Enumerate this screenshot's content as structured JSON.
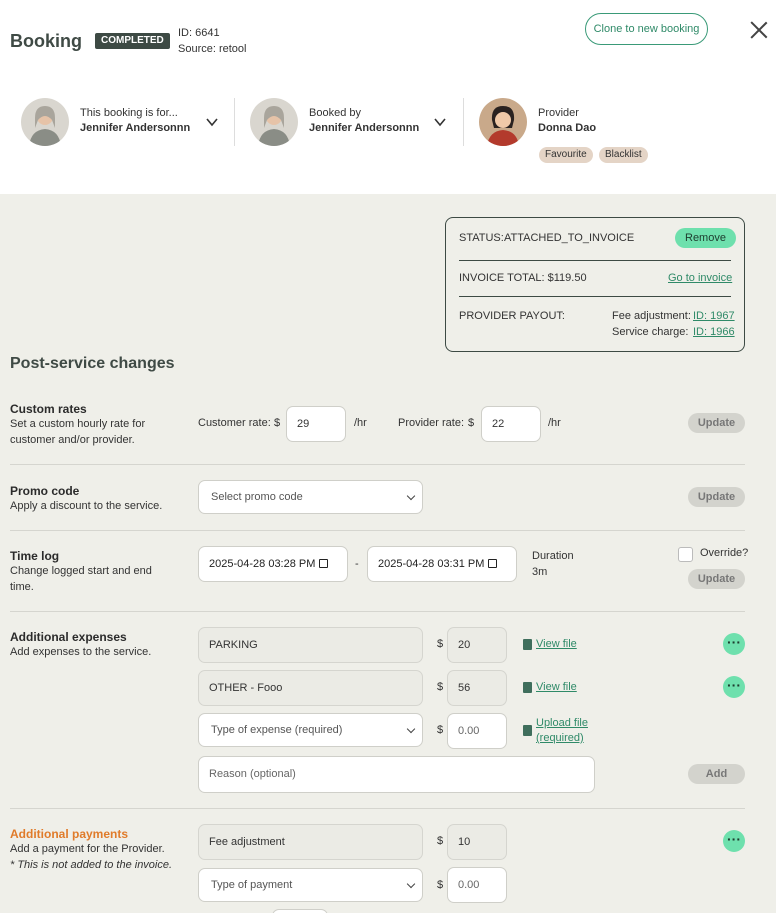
{
  "header": {
    "title": "Booking",
    "status_badge": "COMPLETED",
    "id_line": "ID: 6641",
    "source_line": "Source: retool",
    "clone_button": "Clone to new booking",
    "close_icon": "close-icon"
  },
  "people": [
    {
      "label": "This booking is for...",
      "name": "Jennifer Andersonnn"
    },
    {
      "label": "Booked by",
      "name": "Jennifer Andersonnn"
    },
    {
      "label": "Provider",
      "name": "Donna Dao",
      "tags": [
        "Favourite",
        "Blacklist"
      ]
    }
  ],
  "status_panel": {
    "status_label": "STATUS:",
    "status_value": "ATTACHED_TO_INVOICE",
    "remove_button": "Remove",
    "invoice_total": "INVOICE TOTAL: $119.50",
    "go_to_invoice": "Go to invoice",
    "provider_payout": "PROVIDER PAYOUT:",
    "fee_adjustment_label": "Fee adjustment:",
    "fee_adjustment_link": "ID: 1967",
    "service_charge_label": "Service charge:",
    "service_charge_link": "ID: 1966"
  },
  "post_service": {
    "heading": "Post-service changes",
    "custom_rates": {
      "title": "Custom rates",
      "desc_1": "Set a custom hourly rate for",
      "desc_2": "customer and/or provider.",
      "customer_label": "Customer rate:",
      "currency": "$",
      "customer_value": "29",
      "per_hr": "/hr",
      "provider_label": "Provider rate:",
      "provider_value": "22",
      "update": "Update"
    },
    "promo": {
      "title": "Promo code",
      "desc": "Apply a discount to the service.",
      "placeholder": "Select promo code",
      "update": "Update"
    },
    "time_log": {
      "title": "Time log",
      "desc_1": "Change logged start and end",
      "desc_2": "time.",
      "start": "2025-04-28 03:28 PM",
      "dash": "-",
      "end": "2025-04-28 03:31 PM",
      "duration_label": "Duration",
      "duration_value": "3m",
      "override": "Override?",
      "update": "Update"
    },
    "expenses": {
      "title": "Additional expenses",
      "desc": "Add expenses to the service.",
      "currency": "$",
      "rows": [
        {
          "type": "PARKING",
          "amount": "20",
          "file": "View file"
        },
        {
          "type": "OTHER - Fooo",
          "amount": "56",
          "file": "View file"
        }
      ],
      "new_type_placeholder": "Type of expense (required)",
      "new_amount_placeholder": "0.00",
      "upload_1": "Upload file",
      "upload_2": "(required)",
      "reason_placeholder": "Reason (optional)",
      "add": "Add"
    },
    "payments": {
      "title": "Additional payments",
      "desc": "Add a payment for the Provider.",
      "note": "* This is not added to the invoice.",
      "currency": "$",
      "rows": [
        {
          "type": "Fee adjustment",
          "amount": "10"
        }
      ],
      "new_type_placeholder": "Type of payment",
      "new_amount_placeholder": "0.00"
    }
  },
  "colors": {
    "accent": "#6ee0ad",
    "dark": "#3d4a44",
    "link": "#2f8a68",
    "orange": "#e07b2a"
  }
}
